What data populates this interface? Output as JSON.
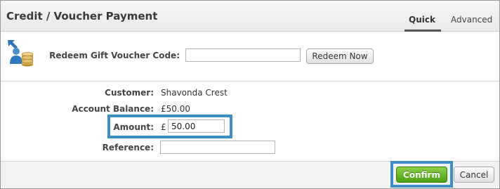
{
  "dialog": {
    "title": "Credit / Voucher Payment",
    "tabs": [
      {
        "label": "Quick",
        "active": true
      },
      {
        "label": "Advanced",
        "active": false
      }
    ]
  },
  "voucher": {
    "icon": "user-with-coins-icon",
    "label": "Redeem Gift Voucher Code:",
    "code_value": "",
    "redeem_button": "Redeem Now"
  },
  "form": {
    "customer_label": "Customer:",
    "customer_value": "Shavonda Crest",
    "balance_label": "Account Balance:",
    "balance_value": "£50.00",
    "amount_label": "Amount:",
    "currency_symbol": "£",
    "amount_value": "50.00",
    "reference_label": "Reference:",
    "reference_value": ""
  },
  "footer": {
    "confirm_button": "Confirm",
    "cancel_button": "Cancel"
  },
  "colors": {
    "highlight": "#3a8fc6",
    "confirm": "#5cb21f"
  }
}
